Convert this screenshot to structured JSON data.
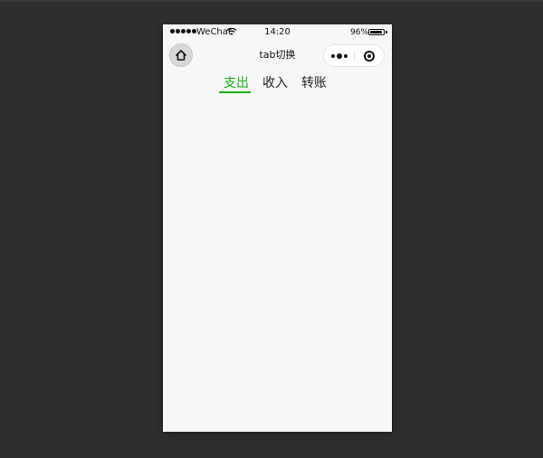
{
  "status_bar": {
    "carrier": "WeChat",
    "time": "14:20",
    "battery": "96%",
    "battery_level": 0.96
  },
  "nav": {
    "title": "tab切换",
    "home_icon": "home-icon",
    "more_icon": "more-dots-icon",
    "close_icon": "target-circle-icon"
  },
  "tabs": [
    {
      "label": "支出",
      "active": true
    },
    {
      "label": "收入",
      "active": false
    },
    {
      "label": "转账",
      "active": false
    }
  ],
  "colors": {
    "accent": "#1aad19",
    "background": "#2e2e2e",
    "page": "#f7f7f7"
  }
}
